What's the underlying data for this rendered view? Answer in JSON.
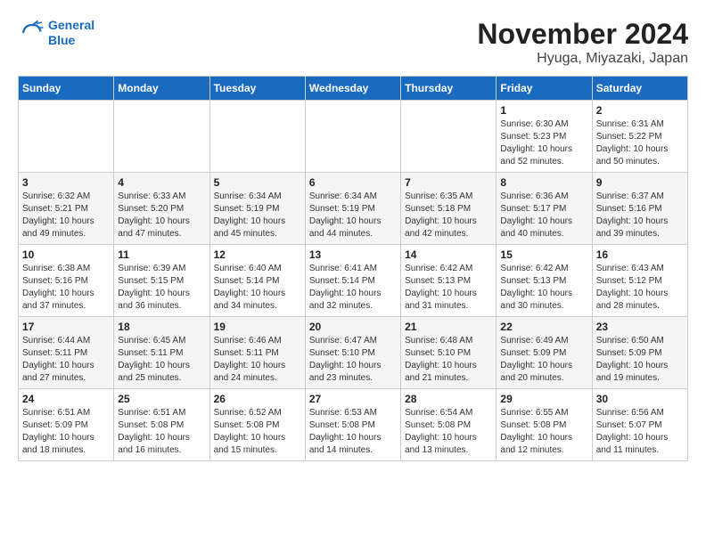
{
  "header": {
    "logo_line1": "General",
    "logo_line2": "Blue",
    "month_title": "November 2024",
    "location": "Hyuga, Miyazaki, Japan"
  },
  "days_of_week": [
    "Sunday",
    "Monday",
    "Tuesday",
    "Wednesday",
    "Thursday",
    "Friday",
    "Saturday"
  ],
  "weeks": [
    [
      null,
      null,
      null,
      null,
      null,
      {
        "day": "1",
        "sunrise": "Sunrise: 6:30 AM",
        "sunset": "Sunset: 5:23 PM",
        "daylight": "Daylight: 10 hours and 52 minutes."
      },
      {
        "day": "2",
        "sunrise": "Sunrise: 6:31 AM",
        "sunset": "Sunset: 5:22 PM",
        "daylight": "Daylight: 10 hours and 50 minutes."
      }
    ],
    [
      {
        "day": "3",
        "sunrise": "Sunrise: 6:32 AM",
        "sunset": "Sunset: 5:21 PM",
        "daylight": "Daylight: 10 hours and 49 minutes."
      },
      {
        "day": "4",
        "sunrise": "Sunrise: 6:33 AM",
        "sunset": "Sunset: 5:20 PM",
        "daylight": "Daylight: 10 hours and 47 minutes."
      },
      {
        "day": "5",
        "sunrise": "Sunrise: 6:34 AM",
        "sunset": "Sunset: 5:19 PM",
        "daylight": "Daylight: 10 hours and 45 minutes."
      },
      {
        "day": "6",
        "sunrise": "Sunrise: 6:34 AM",
        "sunset": "Sunset: 5:19 PM",
        "daylight": "Daylight: 10 hours and 44 minutes."
      },
      {
        "day": "7",
        "sunrise": "Sunrise: 6:35 AM",
        "sunset": "Sunset: 5:18 PM",
        "daylight": "Daylight: 10 hours and 42 minutes."
      },
      {
        "day": "8",
        "sunrise": "Sunrise: 6:36 AM",
        "sunset": "Sunset: 5:17 PM",
        "daylight": "Daylight: 10 hours and 40 minutes."
      },
      {
        "day": "9",
        "sunrise": "Sunrise: 6:37 AM",
        "sunset": "Sunset: 5:16 PM",
        "daylight": "Daylight: 10 hours and 39 minutes."
      }
    ],
    [
      {
        "day": "10",
        "sunrise": "Sunrise: 6:38 AM",
        "sunset": "Sunset: 5:16 PM",
        "daylight": "Daylight: 10 hours and 37 minutes."
      },
      {
        "day": "11",
        "sunrise": "Sunrise: 6:39 AM",
        "sunset": "Sunset: 5:15 PM",
        "daylight": "Daylight: 10 hours and 36 minutes."
      },
      {
        "day": "12",
        "sunrise": "Sunrise: 6:40 AM",
        "sunset": "Sunset: 5:14 PM",
        "daylight": "Daylight: 10 hours and 34 minutes."
      },
      {
        "day": "13",
        "sunrise": "Sunrise: 6:41 AM",
        "sunset": "Sunset: 5:14 PM",
        "daylight": "Daylight: 10 hours and 32 minutes."
      },
      {
        "day": "14",
        "sunrise": "Sunrise: 6:42 AM",
        "sunset": "Sunset: 5:13 PM",
        "daylight": "Daylight: 10 hours and 31 minutes."
      },
      {
        "day": "15",
        "sunrise": "Sunrise: 6:42 AM",
        "sunset": "Sunset: 5:13 PM",
        "daylight": "Daylight: 10 hours and 30 minutes."
      },
      {
        "day": "16",
        "sunrise": "Sunrise: 6:43 AM",
        "sunset": "Sunset: 5:12 PM",
        "daylight": "Daylight: 10 hours and 28 minutes."
      }
    ],
    [
      {
        "day": "17",
        "sunrise": "Sunrise: 6:44 AM",
        "sunset": "Sunset: 5:11 PM",
        "daylight": "Daylight: 10 hours and 27 minutes."
      },
      {
        "day": "18",
        "sunrise": "Sunrise: 6:45 AM",
        "sunset": "Sunset: 5:11 PM",
        "daylight": "Daylight: 10 hours and 25 minutes."
      },
      {
        "day": "19",
        "sunrise": "Sunrise: 6:46 AM",
        "sunset": "Sunset: 5:11 PM",
        "daylight": "Daylight: 10 hours and 24 minutes."
      },
      {
        "day": "20",
        "sunrise": "Sunrise: 6:47 AM",
        "sunset": "Sunset: 5:10 PM",
        "daylight": "Daylight: 10 hours and 23 minutes."
      },
      {
        "day": "21",
        "sunrise": "Sunrise: 6:48 AM",
        "sunset": "Sunset: 5:10 PM",
        "daylight": "Daylight: 10 hours and 21 minutes."
      },
      {
        "day": "22",
        "sunrise": "Sunrise: 6:49 AM",
        "sunset": "Sunset: 5:09 PM",
        "daylight": "Daylight: 10 hours and 20 minutes."
      },
      {
        "day": "23",
        "sunrise": "Sunrise: 6:50 AM",
        "sunset": "Sunset: 5:09 PM",
        "daylight": "Daylight: 10 hours and 19 minutes."
      }
    ],
    [
      {
        "day": "24",
        "sunrise": "Sunrise: 6:51 AM",
        "sunset": "Sunset: 5:09 PM",
        "daylight": "Daylight: 10 hours and 18 minutes."
      },
      {
        "day": "25",
        "sunrise": "Sunrise: 6:51 AM",
        "sunset": "Sunset: 5:08 PM",
        "daylight": "Daylight: 10 hours and 16 minutes."
      },
      {
        "day": "26",
        "sunrise": "Sunrise: 6:52 AM",
        "sunset": "Sunset: 5:08 PM",
        "daylight": "Daylight: 10 hours and 15 minutes."
      },
      {
        "day": "27",
        "sunrise": "Sunrise: 6:53 AM",
        "sunset": "Sunset: 5:08 PM",
        "daylight": "Daylight: 10 hours and 14 minutes."
      },
      {
        "day": "28",
        "sunrise": "Sunrise: 6:54 AM",
        "sunset": "Sunset: 5:08 PM",
        "daylight": "Daylight: 10 hours and 13 minutes."
      },
      {
        "day": "29",
        "sunrise": "Sunrise: 6:55 AM",
        "sunset": "Sunset: 5:08 PM",
        "daylight": "Daylight: 10 hours and 12 minutes."
      },
      {
        "day": "30",
        "sunrise": "Sunrise: 6:56 AM",
        "sunset": "Sunset: 5:07 PM",
        "daylight": "Daylight: 10 hours and 11 minutes."
      }
    ]
  ]
}
